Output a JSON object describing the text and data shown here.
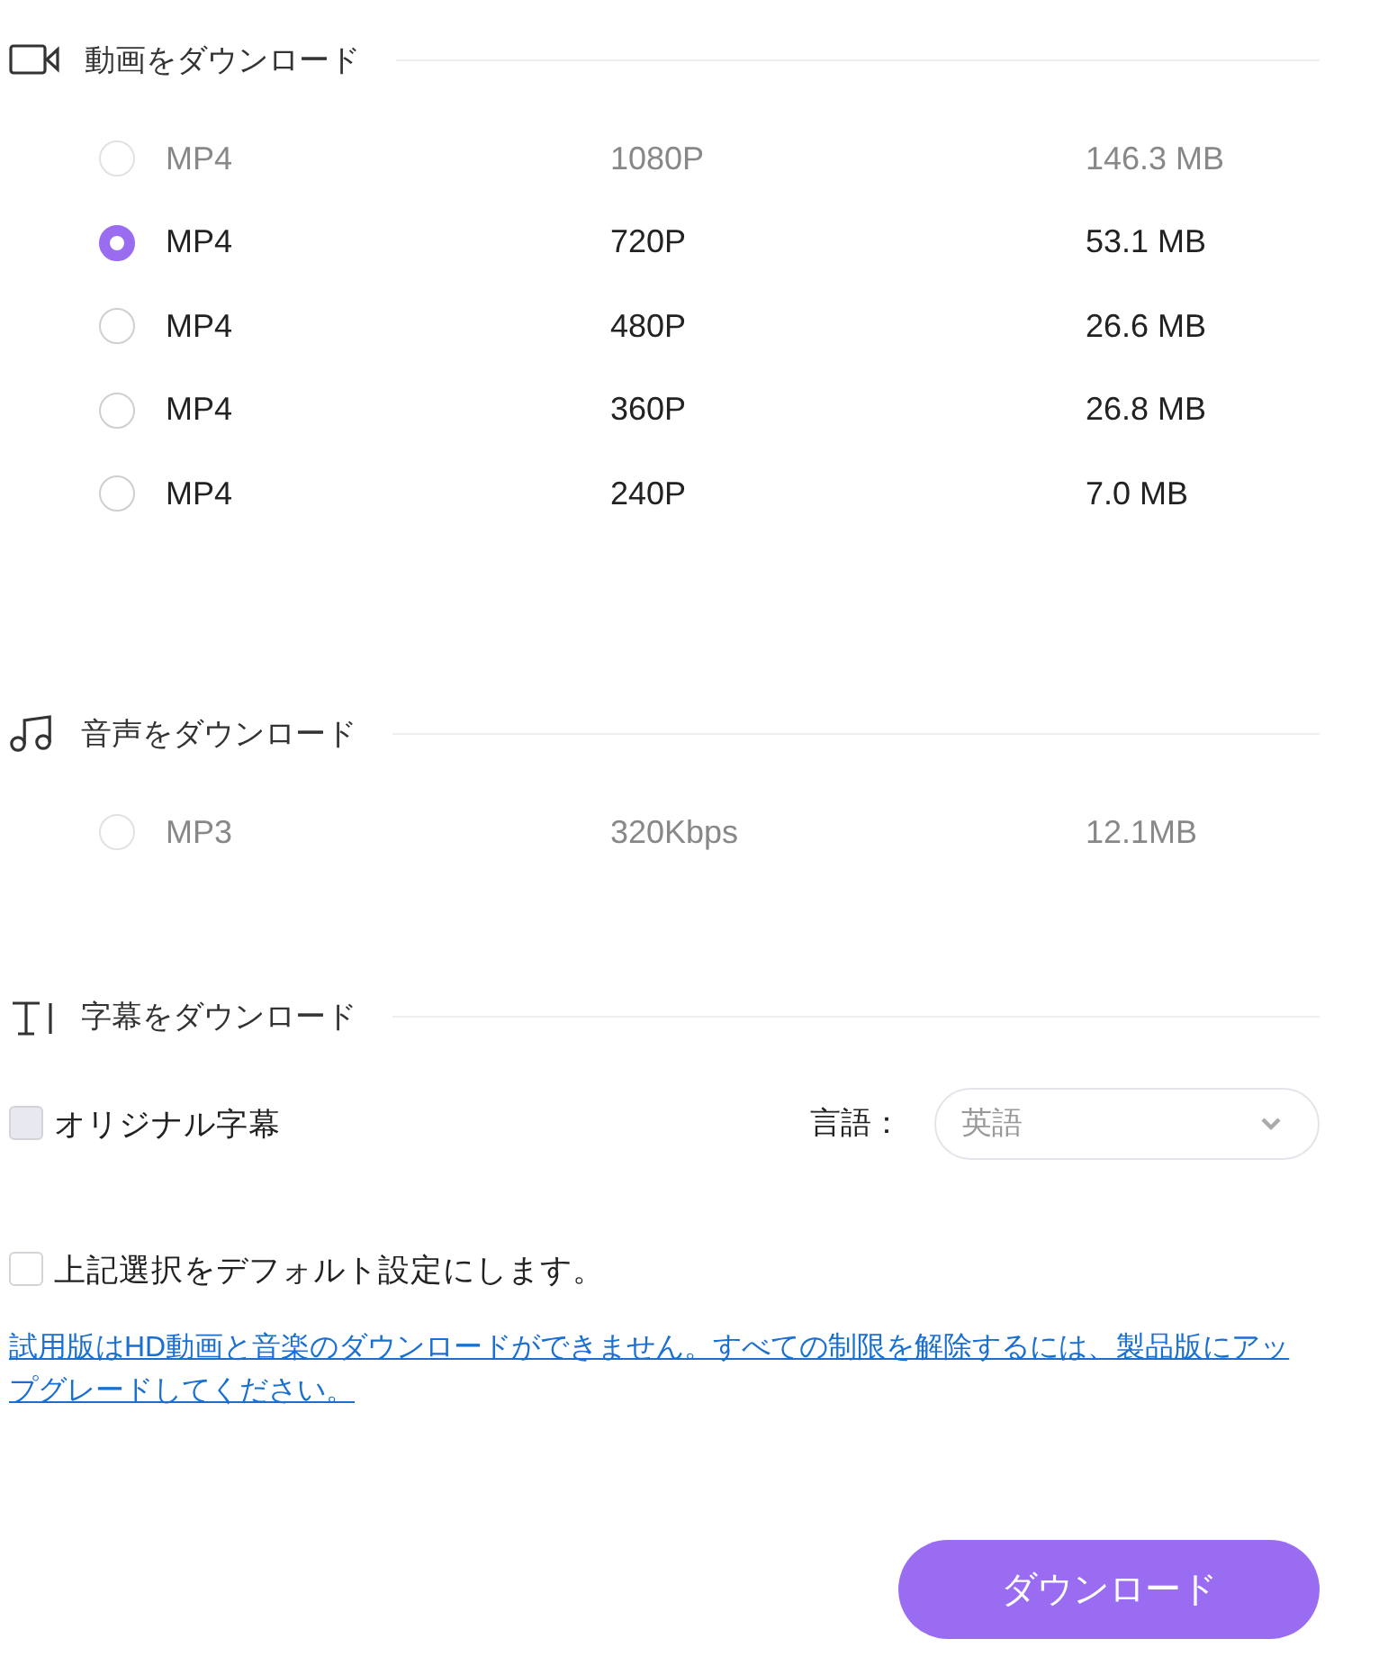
{
  "sections": [
    {
      "kind": "video",
      "title": "動画をダウンロード",
      "options": [
        {
          "format": "MP4",
          "quality": "1080P",
          "size": "146.3 MB",
          "selected": false,
          "disabled": true
        },
        {
          "format": "MP4",
          "quality": "720P",
          "size": "53.1 MB",
          "selected": true,
          "disabled": false
        },
        {
          "format": "MP4",
          "quality": "480P",
          "size": "26.6 MB",
          "selected": false,
          "disabled": false
        },
        {
          "format": "MP4",
          "quality": "360P",
          "size": "26.8 MB",
          "selected": false,
          "disabled": false
        },
        {
          "format": "MP4",
          "quality": "240P",
          "size": "7.0 MB",
          "selected": false,
          "disabled": false
        }
      ]
    },
    {
      "kind": "audio",
      "title": "音声をダウンロード",
      "options": [
        {
          "format": "MP3",
          "quality": "320Kbps",
          "size": "12.1MB",
          "selected": false,
          "disabled": true
        }
      ]
    },
    {
      "kind": "subtitle",
      "title": "字幕をダウンロード"
    }
  ],
  "subtitle": {
    "label": "オリジナル字幕",
    "checked": false,
    "disabled": true,
    "language_label": "言語：",
    "language": "英語",
    "language_disabled": true
  },
  "default_setting": {
    "label": "上記選択をデフォルト設定にします。",
    "checked": false
  },
  "notice": "試用版はHD動画と音楽のダウンロードができません。すべての制限を解除するには、製品版にアップグレードしてください。",
  "download_button": "ダウンロード"
}
